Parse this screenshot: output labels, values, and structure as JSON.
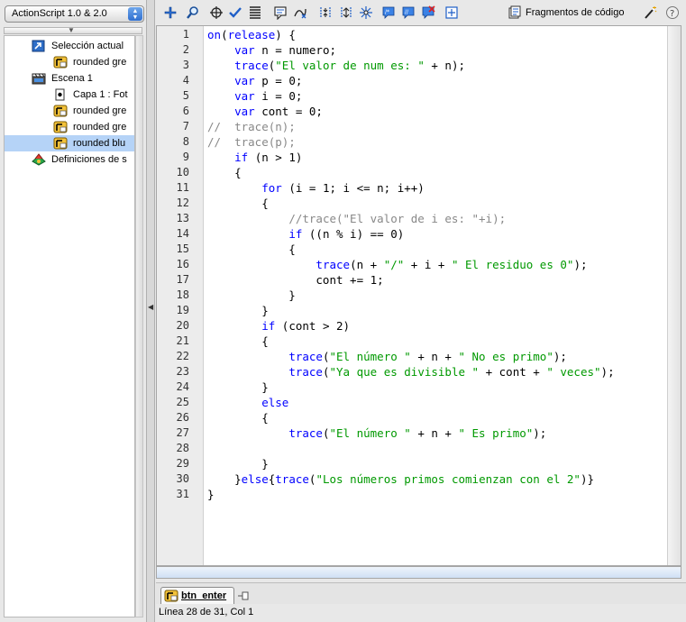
{
  "left_panel": {
    "language_select": "ActionScript 1.0 & 2.0",
    "tree": [
      {
        "label": "Selección actual",
        "icon": "arrow-box-icon",
        "indent": 0,
        "selected": false
      },
      {
        "label": "rounded gre",
        "icon": "button-symbol-icon",
        "indent": 1,
        "selected": false
      },
      {
        "label": "Escena 1",
        "icon": "clapper-icon",
        "indent": 0,
        "selected": false
      },
      {
        "label": "Capa 1 : Fot",
        "icon": "frame-icon",
        "indent": 1,
        "selected": false
      },
      {
        "label": "rounded gre",
        "icon": "button-symbol-icon",
        "indent": 1,
        "selected": false
      },
      {
        "label": "rounded gre",
        "icon": "button-symbol-icon",
        "indent": 1,
        "selected": false
      },
      {
        "label": "rounded blu",
        "icon": "button-symbol-icon",
        "indent": 1,
        "selected": true
      },
      {
        "label": "Definiciones de s",
        "icon": "library-icon",
        "indent": 0,
        "selected": false
      }
    ]
  },
  "toolbar": {
    "icons": [
      "add-statement-icon",
      "find-icon",
      "target-path-icon",
      "check-syntax-icon",
      "auto-format-icon",
      "code-hint-icon",
      "debug-options-icon",
      "collapse-between-braces-icon",
      "collapse-selection-icon",
      "expand-all-icon",
      "apply-block-comment-icon",
      "apply-line-comment-icon",
      "remove-comment-icon",
      "show-hide-toolbox-icon"
    ],
    "snippets_label": "Fragmentos de código",
    "magic_wand_icon": "wand-icon",
    "help_icon": "help-icon"
  },
  "editor": {
    "lines": [
      [
        [
          "kw",
          "on"
        ],
        [
          "",
          "("
        ],
        [
          "kw",
          "release"
        ],
        [
          "",
          ") {"
        ]
      ],
      [
        [
          "",
          "    "
        ],
        [
          "kw",
          "var"
        ],
        [
          "",
          " n = numero;"
        ]
      ],
      [
        [
          "",
          "    "
        ],
        [
          "kw",
          "trace"
        ],
        [
          "",
          "("
        ],
        [
          "st",
          "\"El valor de num es: \""
        ],
        [
          "",
          " + n);"
        ]
      ],
      [
        [
          "",
          "    "
        ],
        [
          "kw",
          "var"
        ],
        [
          "",
          " p = 0;"
        ]
      ],
      [
        [
          "",
          "    "
        ],
        [
          "kw",
          "var"
        ],
        [
          "",
          " i = 0;"
        ]
      ],
      [
        [
          "",
          "    "
        ],
        [
          "kw",
          "var"
        ],
        [
          "",
          " cont = 0;"
        ]
      ],
      [
        [
          "cm",
          "//  trace(n);"
        ]
      ],
      [
        [
          "cm",
          "//  trace(p);"
        ]
      ],
      [
        [
          "",
          "    "
        ],
        [
          "kw",
          "if"
        ],
        [
          "",
          " (n > 1)"
        ]
      ],
      [
        [
          "",
          "    {"
        ]
      ],
      [
        [
          "",
          "        "
        ],
        [
          "kw",
          "for"
        ],
        [
          "",
          " (i = 1; i <= n; i++)"
        ]
      ],
      [
        [
          "",
          "        {"
        ]
      ],
      [
        [
          "",
          "            "
        ],
        [
          "cm",
          "//trace(\"El valor de i es: \"+i);"
        ]
      ],
      [
        [
          "",
          "            "
        ],
        [
          "kw",
          "if"
        ],
        [
          "",
          " ((n % i) == 0)"
        ]
      ],
      [
        [
          "",
          "            {"
        ]
      ],
      [
        [
          "",
          "                "
        ],
        [
          "kw",
          "trace"
        ],
        [
          "",
          "(n + "
        ],
        [
          "st",
          "\"/\""
        ],
        [
          "",
          " + i + "
        ],
        [
          "st",
          "\" El residuo es 0\""
        ],
        [
          "",
          ");"
        ]
      ],
      [
        [
          "",
          "                cont += 1;"
        ]
      ],
      [
        [
          "",
          "            }"
        ]
      ],
      [
        [
          "",
          "        }"
        ]
      ],
      [
        [
          "",
          "        "
        ],
        [
          "kw",
          "if"
        ],
        [
          "",
          " (cont > 2)"
        ]
      ],
      [
        [
          "",
          "        {"
        ]
      ],
      [
        [
          "",
          "            "
        ],
        [
          "kw",
          "trace"
        ],
        [
          "",
          "("
        ],
        [
          "st",
          "\"El número \""
        ],
        [
          "",
          " + n + "
        ],
        [
          "st",
          "\" No es primo\""
        ],
        [
          "",
          ");"
        ]
      ],
      [
        [
          "",
          "            "
        ],
        [
          "kw",
          "trace"
        ],
        [
          "",
          "("
        ],
        [
          "st",
          "\"Ya que es divisible \""
        ],
        [
          "",
          " + cont + "
        ],
        [
          "st",
          "\" veces\""
        ],
        [
          "",
          ");"
        ]
      ],
      [
        [
          "",
          "        }"
        ]
      ],
      [
        [
          "",
          "        "
        ],
        [
          "kw",
          "else"
        ]
      ],
      [
        [
          "",
          "        {"
        ]
      ],
      [
        [
          "",
          "            "
        ],
        [
          "kw",
          "trace"
        ],
        [
          "",
          "("
        ],
        [
          "st",
          "\"El número \""
        ],
        [
          "",
          " + n + "
        ],
        [
          "st",
          "\" Es primo\""
        ],
        [
          "",
          ");"
        ]
      ],
      [
        [
          "",
          ""
        ]
      ],
      [
        [
          "",
          "        }"
        ]
      ],
      [
        [
          "",
          "    }"
        ],
        [
          "kw",
          "else"
        ],
        [
          "",
          "{"
        ],
        [
          "kw",
          "trace"
        ],
        [
          "",
          "("
        ],
        [
          "st",
          "\"Los números primos comienzan con el 2\""
        ],
        [
          "",
          ")}"
        ]
      ],
      [
        [
          "",
          "}"
        ]
      ]
    ]
  },
  "bottom": {
    "tab_label": "btn_enter",
    "status": "Línea 28 de 31, Col 1"
  },
  "colors": {
    "keyword": "#0000ff",
    "string": "#009900",
    "comment": "#888888",
    "selection": "#b5d3f7"
  }
}
